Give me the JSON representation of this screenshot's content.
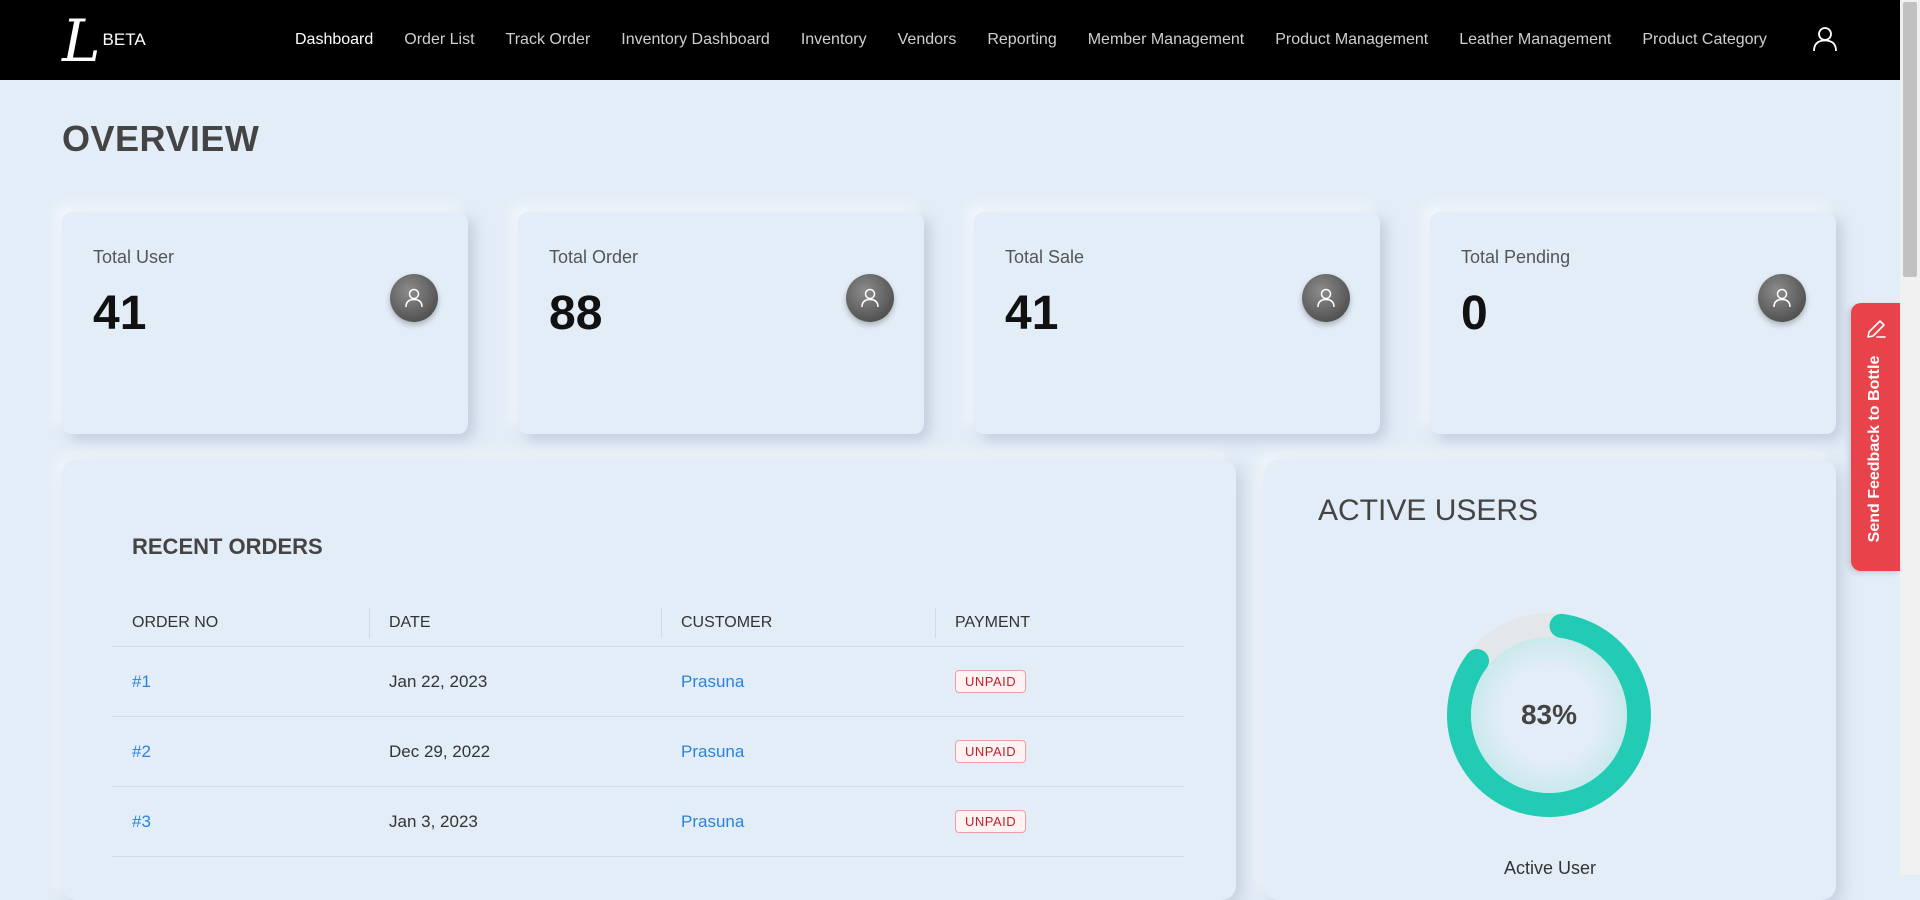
{
  "nav": {
    "logo_mark": "L",
    "logo_badge": "BETA",
    "items": [
      {
        "label": "Dashboard",
        "active": true
      },
      {
        "label": "Order List"
      },
      {
        "label": "Track Order"
      },
      {
        "label": "Inventory Dashboard"
      },
      {
        "label": "Inventory"
      },
      {
        "label": "Vendors"
      },
      {
        "label": "Reporting"
      },
      {
        "label": "Member Management"
      },
      {
        "label": "Product Management"
      },
      {
        "label": "Leather Management"
      },
      {
        "label": "Product Category"
      }
    ],
    "user_icon": "user-icon"
  },
  "overview": {
    "title": "OVERVIEW",
    "cards": [
      {
        "label": "Total User",
        "value": "41",
        "icon": "user-avatar-icon"
      },
      {
        "label": "Total Order",
        "value": "88",
        "icon": "user-avatar-icon"
      },
      {
        "label": "Total Sale",
        "value": "41",
        "icon": "user-avatar-icon"
      },
      {
        "label": "Total Pending",
        "value": "0",
        "icon": "user-avatar-icon"
      }
    ]
  },
  "recent_orders": {
    "title": "RECENT ORDERS",
    "columns": [
      "ORDER NO",
      "DATE",
      "CUSTOMER",
      "PAYMENT"
    ],
    "rows": [
      {
        "order_no": "#1",
        "date": "Jan 22, 2023",
        "customer": "Prasuna",
        "payment": "UNPAID"
      },
      {
        "order_no": "#2",
        "date": "Dec 29, 2022",
        "customer": "Prasuna",
        "payment": "UNPAID"
      },
      {
        "order_no": "#3",
        "date": "Jan 3, 2023",
        "customer": "Prasuna",
        "payment": "UNPAID"
      }
    ]
  },
  "active_users": {
    "title": "ACTIVE USERS",
    "percent": 83,
    "percent_label": "83%",
    "caption": "Active User",
    "colors": {
      "fill": "#22cbb4",
      "track": "#e4e7ea"
    }
  },
  "feedback": {
    "label": "Send Feedback to Bottle",
    "icon": "pencil-icon",
    "color": "#e8434a"
  }
}
